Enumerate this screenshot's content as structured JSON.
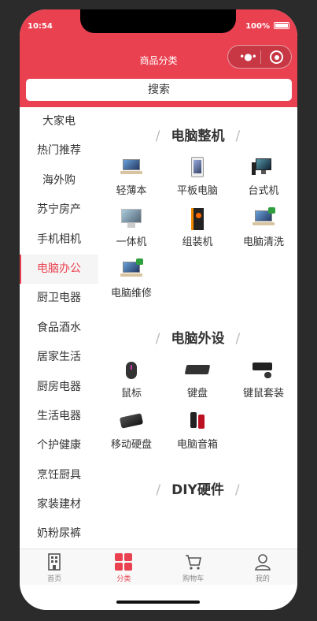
{
  "status": {
    "time": "10:54",
    "battery": "100%"
  },
  "navbar": {
    "title": "商品分类"
  },
  "search": {
    "label": "搜索"
  },
  "sidebar": {
    "items": [
      {
        "label": "大家电"
      },
      {
        "label": "热门推荐"
      },
      {
        "label": "海外购"
      },
      {
        "label": "苏宁房产"
      },
      {
        "label": "手机相机"
      },
      {
        "label": "电脑办公",
        "active": true
      },
      {
        "label": "厨卫电器"
      },
      {
        "label": "食品酒水"
      },
      {
        "label": "居家生活"
      },
      {
        "label": "厨房电器"
      },
      {
        "label": "生活电器"
      },
      {
        "label": "个护健康"
      },
      {
        "label": "烹饪厨具"
      },
      {
        "label": "家装建材"
      },
      {
        "label": "奶粉尿裤"
      }
    ]
  },
  "sections": [
    {
      "title": "电脑整机",
      "items": [
        {
          "label": "轻薄本",
          "icon": "laptop-icon"
        },
        {
          "label": "平板电脑",
          "icon": "tablet-icon"
        },
        {
          "label": "台式机",
          "icon": "desktop-icon"
        },
        {
          "label": "一体机",
          "icon": "all-in-one-icon"
        },
        {
          "label": "组装机",
          "icon": "pc-case-icon"
        },
        {
          "label": "电脑清洗",
          "icon": "laptop-clean-icon"
        },
        {
          "label": "电脑维修",
          "icon": "laptop-repair-icon"
        }
      ]
    },
    {
      "title": "电脑外设",
      "items": [
        {
          "label": "鼠标",
          "icon": "mouse-icon"
        },
        {
          "label": "键盘",
          "icon": "keyboard-icon"
        },
        {
          "label": "键鼠套装",
          "icon": "keyboard-mouse-set-icon"
        },
        {
          "label": "移动硬盘",
          "icon": "external-hdd-icon"
        },
        {
          "label": "电脑音箱",
          "icon": "speaker-icon"
        }
      ]
    },
    {
      "title": "DIY硬件",
      "items": []
    }
  ],
  "tabbar": {
    "tabs": [
      {
        "label": "首页",
        "icon": "home-building-icon"
      },
      {
        "label": "分类",
        "icon": "category-grid-icon",
        "active": true
      },
      {
        "label": "购物车",
        "icon": "cart-icon"
      },
      {
        "label": "我的",
        "icon": "user-icon"
      }
    ]
  },
  "colors": {
    "brand": "#ea4150",
    "text": "#333333"
  }
}
